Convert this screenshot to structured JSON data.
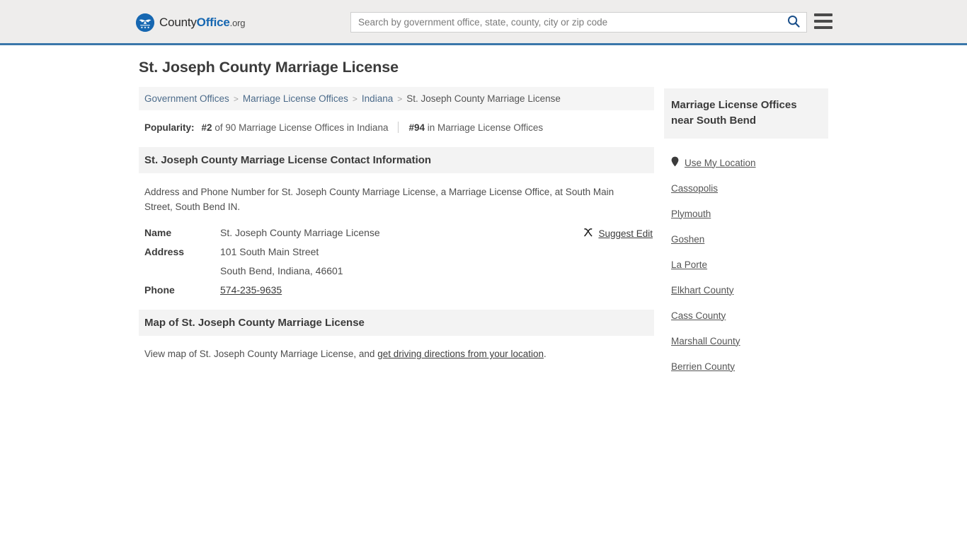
{
  "header": {
    "logo": {
      "icon": "eagle-seal-icon",
      "text_part1": "County",
      "text_part2": "Office",
      "text_part3": ".org"
    },
    "search": {
      "placeholder": "Search by government office, state, county, city or zip code",
      "value": "",
      "search_icon": "search-icon"
    },
    "menu_icon": "hamburger-menu-icon",
    "accent_color": "#1667b1",
    "border_color": "#3a77aa",
    "background": "#eeedec"
  },
  "main": {
    "title": "St. Joseph County Marriage License",
    "breadcrumb": [
      {
        "label": "Government Offices",
        "current": false
      },
      {
        "label": "Marriage License Offices",
        "current": false
      },
      {
        "label": "Indiana",
        "current": false
      },
      {
        "label": "St. Joseph County Marriage License",
        "current": true
      }
    ],
    "breadcrumb_separator": ">",
    "popularity": {
      "label": "Popularity:",
      "rank_state": "#2",
      "rank_state_text": "of 90 Marriage License Offices in Indiana",
      "rank_national": "#94",
      "rank_national_text": "in Marriage License Offices"
    },
    "contact_section": {
      "heading": "St. Joseph County Marriage License Contact Information",
      "intro": "Address and Phone Number for St. Joseph County Marriage License, a Marriage License Office, at South Main Street, South Bend IN.",
      "rows": [
        {
          "key": "Name",
          "value": "St. Joseph County Marriage License",
          "link": false
        },
        {
          "key": "Address",
          "value": "101 South Main Street",
          "link": false
        },
        {
          "key": "",
          "value": "South Bend, Indiana, 46601",
          "link": false
        },
        {
          "key": "Phone",
          "value": "574-235-9635",
          "link": true
        }
      ],
      "suggest_edit": {
        "label": "Suggest Edit",
        "icon": "pencil-edit-icon"
      }
    },
    "map_section": {
      "heading": "Map of St. Joseph County Marriage License",
      "text_before": "View map of St. Joseph County Marriage License, and ",
      "link_text": "get driving directions from your location",
      "text_after": "."
    }
  },
  "sidebar": {
    "heading": "Marriage License Offices near South Bend",
    "use_my_location": {
      "label": "Use My Location",
      "icon": "map-pin-icon"
    },
    "items": [
      {
        "label": "Cassopolis"
      },
      {
        "label": "Plymouth"
      },
      {
        "label": "Goshen"
      },
      {
        "label": "La Porte"
      },
      {
        "label": "Elkhart County"
      },
      {
        "label": "Cass County"
      },
      {
        "label": "Marshall County"
      },
      {
        "label": "Berrien County"
      }
    ]
  }
}
